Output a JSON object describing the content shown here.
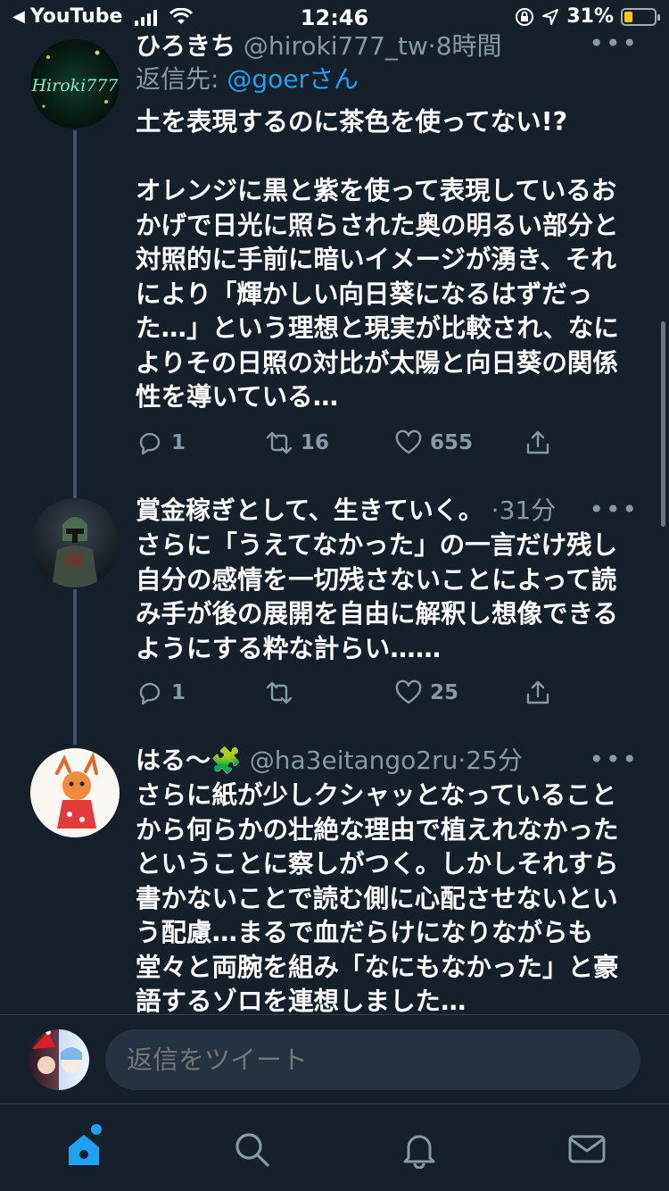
{
  "status_bar": {
    "back_app": "YouTube",
    "time": "12:46",
    "battery_pct": "31%"
  },
  "tweets": [
    {
      "name": "ひろきち",
      "handle": "@hiroki777_tw",
      "time": "8時間",
      "reply_label": "返信先:",
      "reply_mention": "@goerさん",
      "avatar_text": "Hiroki777",
      "text": "土を表現するのに茶色を使ってない!?\n\nオレンジに黒と紫を使って表現しているおかげで日光に照らされた奥の明るい部分と対照的に手前に暗いイメージが湧き、それにより「輝かしい向日葵になるはずだった…」という理想と現実が比較され、なによりその日照の対比が太陽と向日葵の関係性を導いている…",
      "replies": "1",
      "retweets": "16",
      "likes": "655"
    },
    {
      "name": "賞金稼ぎとして、生きていく。",
      "handle": "",
      "time": "31分",
      "text": "さらに「うえてなかった」の一言だけ残し自分の感情を一切残さないことによって読み手が後の展開を自由に解釈し想像できるようにする粋な計らい……",
      "replies": "1",
      "retweets": "",
      "likes": "25"
    },
    {
      "name": "はる〜🧩",
      "handle": "@ha3eitango2ru",
      "time": "25分",
      "text": "さらに紙が少しクシャッとなっていることから何らかの壮絶な理由で植えれなかったということに察しがつく。しかしそれすら書かないことで読む側に心配させないという配慮…まるで血だらけになりながらも堂々と両腕を組み「なにもなかった」と豪語するゾロを連想しました…"
    }
  ],
  "composer": {
    "placeholder": "返信をツイート"
  },
  "colors": {
    "background": "#15202b",
    "accent": "#1da1f2",
    "muted": "#8899a6"
  }
}
